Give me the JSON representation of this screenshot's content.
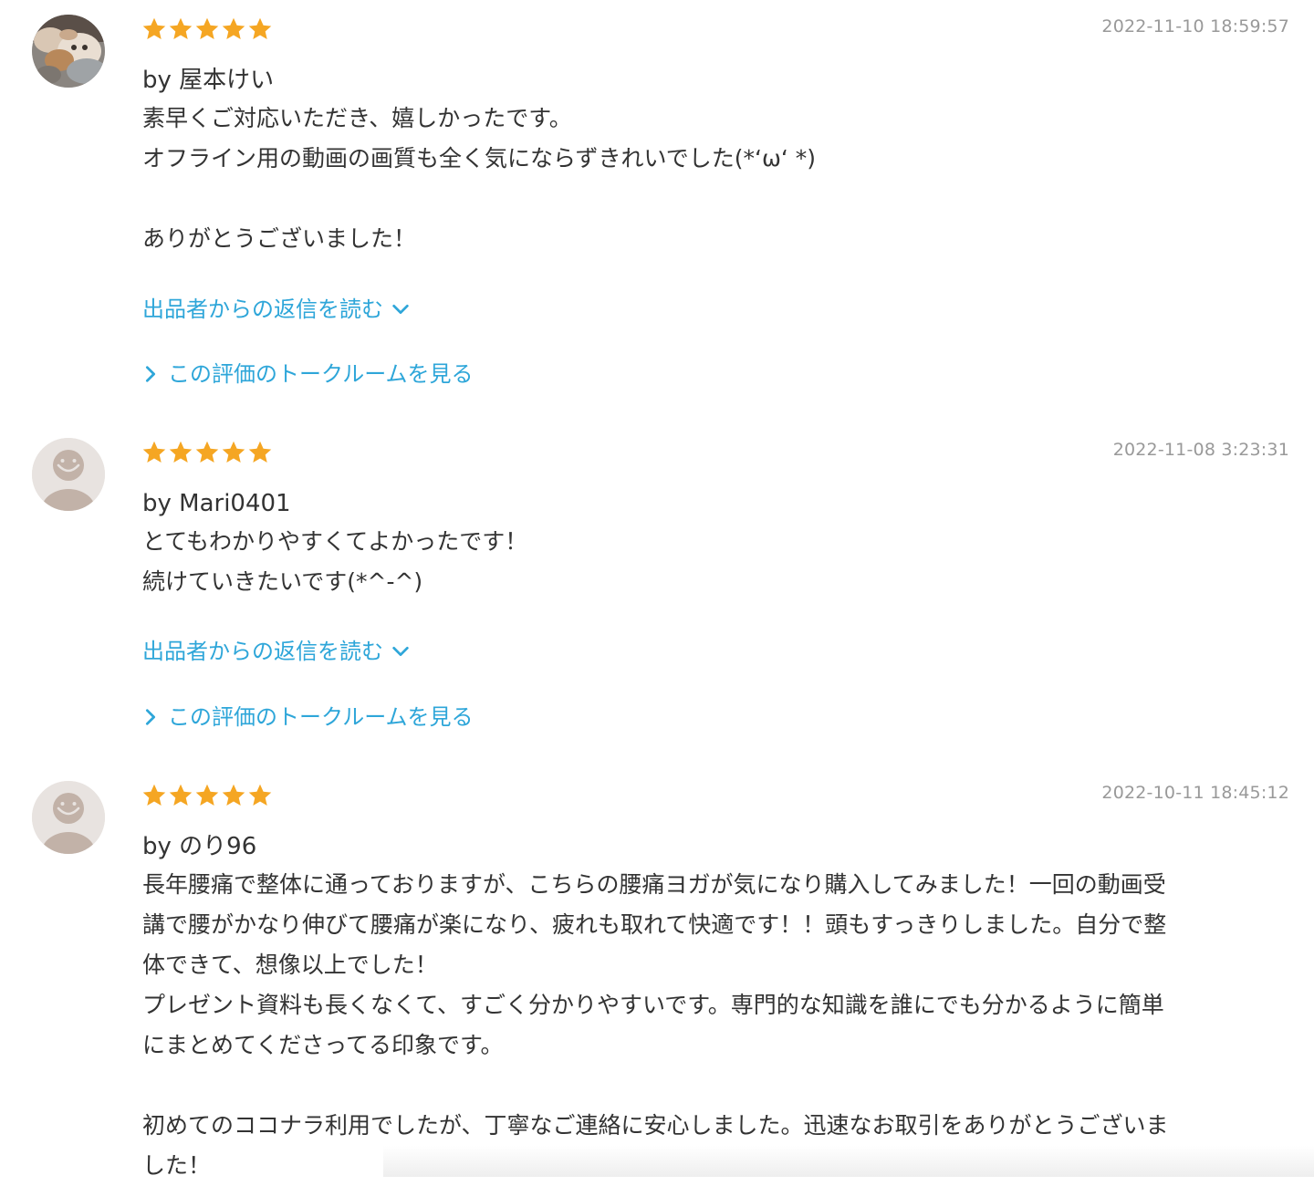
{
  "reviews": [
    {
      "rating": 5,
      "date": "2022-11-10 18:59:57",
      "author": "by 屋本けい",
      "body": "素早くご対応いただき、嬉しかったです。\nオフライン用の動画の画質も全く気にならずきれいでした(*‘ω‘ *)\n\nありがとうございました！",
      "reply_label": "出品者からの返信を読む",
      "talk_label": "この評価のトークルームを見る",
      "avatar": "cat-photo-avatar"
    },
    {
      "rating": 5,
      "date": "2022-11-08 3:23:31",
      "author": "by Mari0401",
      "body": "とてもわかりやすくてよかったです！\n続けていきたいです(*^-^)",
      "reply_label": "出品者からの返信を読む",
      "talk_label": "この評価のトークルームを見る",
      "avatar": "default-user-avatar"
    },
    {
      "rating": 5,
      "date": "2022-10-11 18:45:12",
      "author": "by のり96",
      "body": "長年腰痛で整体に通っておりますが、こちらの腰痛ヨガが気になり購入してみました！一回の動画受\n講で腰がかなり伸びて腰痛が楽になり、疲れも取れて快適です！！頭もすっきりしました。自分で整\n体できて、想像以上でした！\nプレゼント資料も長くなくて、すごく分かりやすいです。専門的な知識を誰にでも分かるように簡単\nにまとめてくださってる印象です。\n\n初めてのココナラ利用でしたが、丁寧なご連絡に安心しました。迅速なお取引をありがとうございま\nした！",
      "avatar": "default-user-avatar"
    }
  ],
  "colors": {
    "star": "#f5a623",
    "link": "#2ea6d9",
    "date": "#999999",
    "text": "#333333",
    "avatar_bg": "#e8e3e0",
    "avatar_figure": "#c2b2a8"
  },
  "icons": {
    "star": "star-icon",
    "reply_toggle": "chevron-down-icon",
    "talk_link": "chevron-right-icon"
  }
}
